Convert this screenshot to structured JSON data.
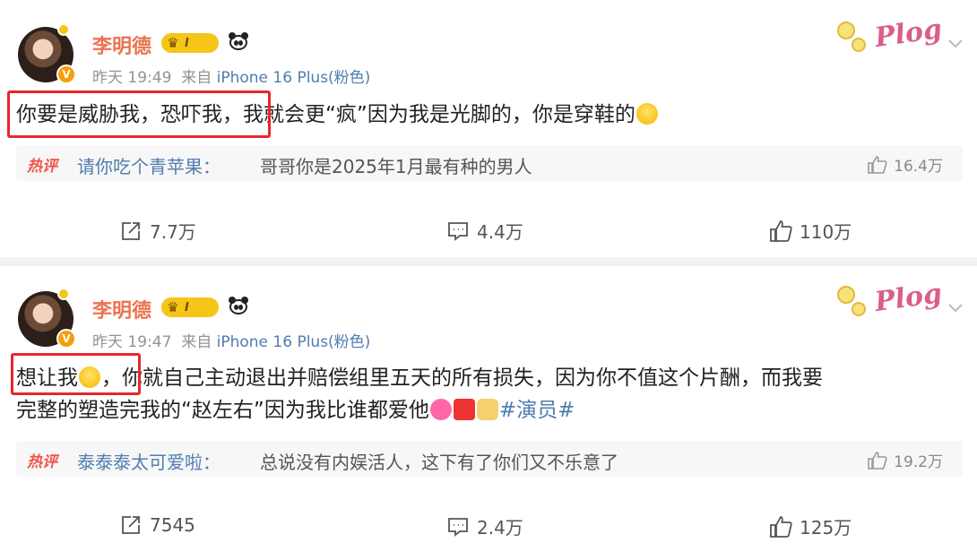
{
  "posts": [
    {
      "user": {
        "name": "李明德",
        "vip_level": "I"
      },
      "meta": {
        "time": "昨天 19:49",
        "from_label": "来自",
        "device": "iPhone 16 Plus(粉色)"
      },
      "badge_text": "Plog",
      "content": {
        "highlight": "你要是威胁我，恐吓我，",
        "rest": "我就会更“疯”因为我是光脚的，你是穿鞋的"
      },
      "hot_comment": {
        "tag": "热评",
        "user": "请你吃个青苹果",
        "sep": "：",
        "text": "哥哥你是2025年1月最有种的男人",
        "likes": "16.4万"
      },
      "actions": {
        "forward": "7.7万",
        "comment": "4.4万",
        "like": "110万"
      }
    },
    {
      "user": {
        "name": "李明德",
        "vip_level": "I"
      },
      "meta": {
        "time": "昨天 19:47",
        "from_label": "来自",
        "device": "iPhone 16 Plus(粉色)"
      },
      "badge_text": "Plog",
      "content": {
        "highlight": "想让我",
        "rest_line1": "，你就自己主动退出并赔偿组里五天的所有损失，因为你不值这个片酬，而我要",
        "rest_line2": "完整的塑造完我的“赵左右”因为我比谁都爱他",
        "hashtag": "#演员#"
      },
      "hot_comment": {
        "tag": "热评",
        "user": "泰泰泰太可爱啦",
        "sep": "：",
        "text": "总说没有内娱活人，这下有了你们又不乐意了",
        "likes": "19.2万"
      },
      "actions": {
        "forward": "7545",
        "comment": "2.4万",
        "like": "125万"
      }
    }
  ],
  "colors": {
    "name": "#eb7350",
    "link": "#507daf",
    "highlight_box": "#e8262c",
    "hot_tag": "#f0544b",
    "vip": "#f5c518"
  }
}
